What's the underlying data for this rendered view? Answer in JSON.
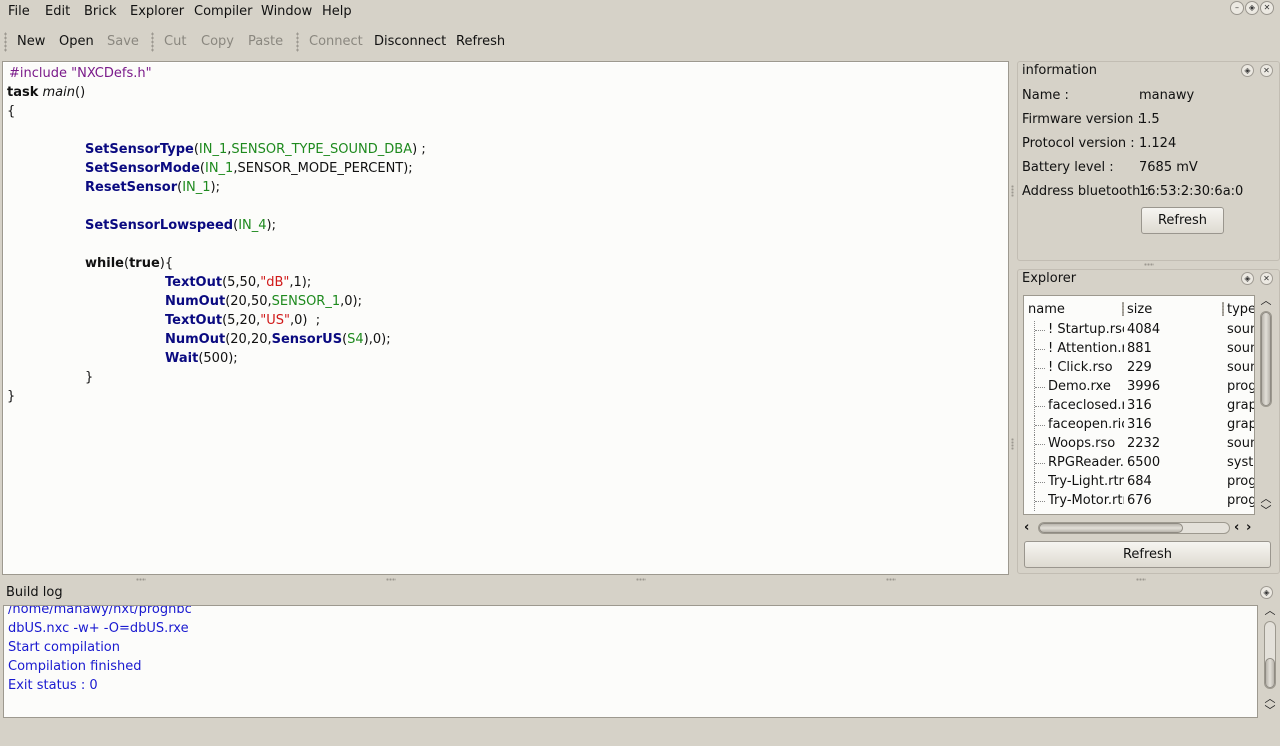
{
  "menubar": {
    "items": [
      {
        "u": "F",
        "rest": "ile"
      },
      {
        "u": "E",
        "rest": "dit"
      },
      {
        "u": "B",
        "rest": "rick"
      },
      {
        "u": "",
        "pre": "E",
        "u2": "x",
        "rest": "plorer"
      },
      {
        "u": "C",
        "rest": "ompiler"
      },
      {
        "u": "W",
        "rest": "indow"
      },
      {
        "u": "H",
        "rest": "elp"
      }
    ],
    "labels": [
      "File",
      "Edit",
      "Brick",
      "Explorer",
      "Compiler",
      "Window",
      "Help"
    ]
  },
  "toolbar": {
    "new": "New",
    "open": "Open",
    "save": "Save",
    "cut": "Cut",
    "copy": "Copy",
    "paste": "Paste",
    "connect": "Connect",
    "disconnect": "Disconnect",
    "refresh": "Refresh"
  },
  "editor": {
    "code": [
      [
        {
          "t": "#include \"NXCDefs.h\"",
          "c": "pp"
        }
      ],
      [
        {
          "t": "task",
          "c": "kw"
        },
        {
          "t": " "
        },
        {
          "t": "main",
          "c": "it"
        },
        {
          "t": "()"
        }
      ],
      [
        {
          "t": "{"
        }
      ],
      [],
      [
        {
          "t": "SetSensorType",
          "c": "fn"
        },
        {
          "t": "("
        },
        {
          "t": "IN_1",
          "c": "cst"
        },
        {
          "t": ","
        },
        {
          "t": "SENSOR_TYPE_SOUND_DBA",
          "c": "cst"
        },
        {
          "t": ") ;"
        }
      ],
      [
        {
          "t": "SetSensorMode",
          "c": "fn"
        },
        {
          "t": "("
        },
        {
          "t": "IN_1",
          "c": "cst"
        },
        {
          "t": ",SENSOR_MODE_PERCENT);"
        }
      ],
      [
        {
          "t": "ResetSensor",
          "c": "fn"
        },
        {
          "t": "("
        },
        {
          "t": "IN_1",
          "c": "cst"
        },
        {
          "t": ");"
        }
      ],
      [],
      [
        {
          "t": "SetSensorLowspeed",
          "c": "fn"
        },
        {
          "t": "("
        },
        {
          "t": "IN_4",
          "c": "cst"
        },
        {
          "t": ");"
        }
      ],
      [],
      [
        {
          "t": "while",
          "c": "kw"
        },
        {
          "t": "("
        },
        {
          "t": "true",
          "c": "kw"
        },
        {
          "t": "){"
        }
      ],
      [
        {
          "t": "TextOut",
          "c": "fn"
        },
        {
          "t": "(5,50,"
        },
        {
          "t": "\"dB\"",
          "c": "str"
        },
        {
          "t": ",1);"
        }
      ],
      [
        {
          "t": "NumOut",
          "c": "fn"
        },
        {
          "t": "(20,50,"
        },
        {
          "t": "SENSOR_1",
          "c": "cst"
        },
        {
          "t": ",0);"
        }
      ],
      [
        {
          "t": "TextOut",
          "c": "fn"
        },
        {
          "t": "(5,20,"
        },
        {
          "t": "\"US\"",
          "c": "str"
        },
        {
          "t": ",0)  ;"
        }
      ],
      [
        {
          "t": "NumOut",
          "c": "fn"
        },
        {
          "t": "(20,20,"
        },
        {
          "t": "SensorUS",
          "c": "fn"
        },
        {
          "t": "("
        },
        {
          "t": "S4",
          "c": "cst"
        },
        {
          "t": "),0);"
        }
      ],
      [
        {
          "t": "Wait",
          "c": "fn"
        },
        {
          "t": "(500);"
        }
      ],
      [
        {
          "t": "}"
        }
      ],
      [
        {
          "t": "}"
        }
      ]
    ],
    "indent_levels": [
      0,
      0,
      0,
      0,
      1,
      1,
      1,
      0,
      1,
      0,
      1,
      2,
      2,
      2,
      2,
      2,
      1,
      0
    ]
  },
  "information": {
    "title": "information",
    "rows": [
      {
        "label": "Name :",
        "value": "manawy"
      },
      {
        "label": "Firmware version :",
        "value": "1.5"
      },
      {
        "label": "Protocol version :",
        "value": "1.124"
      },
      {
        "label": "Battery level :",
        "value": "7685 mV"
      },
      {
        "label": "Address bluetooth :",
        "value": "16:53:2:30:6a:0"
      }
    ],
    "refresh": "Refresh"
  },
  "explorer": {
    "title": "Explorer",
    "columns": [
      "name",
      "size",
      "type"
    ],
    "files": [
      {
        "name": "! Startup.rso",
        "size": "4084",
        "type": "sound"
      },
      {
        "name": "! Attention.rso",
        "size": "881",
        "type": "sound"
      },
      {
        "name": "! Click.rso",
        "size": "229",
        "type": "sound"
      },
      {
        "name": "Demo.rxe",
        "size": "3996",
        "type": "program"
      },
      {
        "name": "faceclosed.ric",
        "size": "316",
        "type": "graphic"
      },
      {
        "name": "faceopen.ric",
        "size": "316",
        "type": "graphic"
      },
      {
        "name": "Woops.rso",
        "size": "2232",
        "type": "sound"
      },
      {
        "name": "RPGReader.sys",
        "size": "6500",
        "type": "system"
      },
      {
        "name": "Try-Light.rtm",
        "size": "684",
        "type": "program"
      },
      {
        "name": "Try-Motor.rtm",
        "size": "676",
        "type": "program"
      }
    ],
    "refresh": "Refresh"
  },
  "buildlog": {
    "title": "Build log",
    "lines": [
      "/home/manawy/nxt/prognbc",
      "dbUS.nxc -w+ -O=dbUS.rxe",
      "Start compilation",
      "Compilation finished",
      "Exit status : 0"
    ]
  },
  "icons": {
    "window": [
      "minimize-icon",
      "float-icon",
      "close-icon"
    ],
    "panel": [
      "float-icon",
      "close-icon"
    ]
  }
}
